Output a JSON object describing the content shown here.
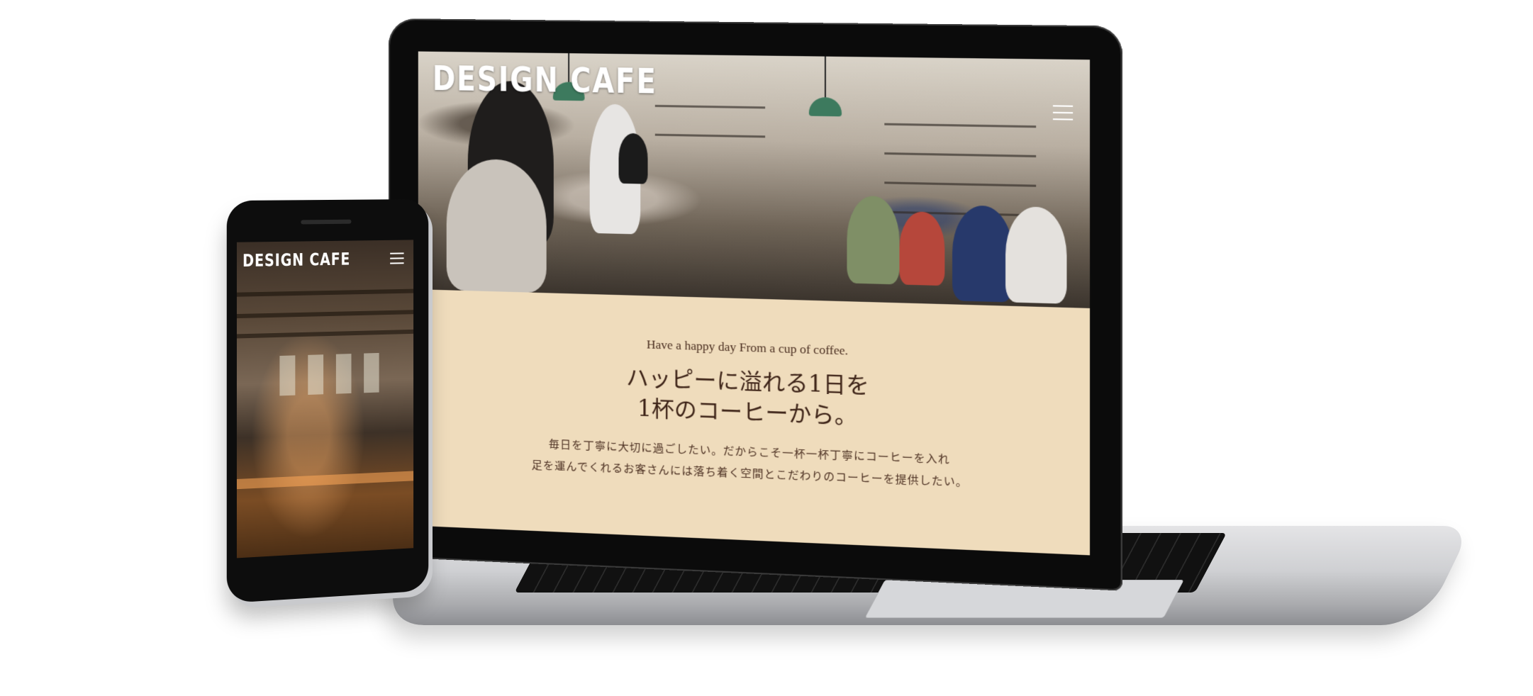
{
  "brand": "DESIGN CAFE",
  "laptop": {
    "tagline": "Have a happy day From a cup of coffee.",
    "headline_line1": "ハッピーに溢れる1日を",
    "headline_line2": "1杯のコーヒーから。",
    "body_line1": "毎日を丁寧に大切に過ごしたい。だからこそ一杯一杯丁寧にコーヒーを入れ",
    "body_line2": "足を運んでくれるお客さんには落ち着く空間とこだわりのコーヒーを提供したい。",
    "menu_icon": "hamburger-menu-icon"
  },
  "phone": {
    "menu_icon": "hamburger-menu-icon"
  },
  "colors": {
    "intro_background": "#efdcbc",
    "text_brown": "#4a2c1f",
    "device_black": "#0b0b0b",
    "laptop_silver": "#cfd0d3"
  }
}
